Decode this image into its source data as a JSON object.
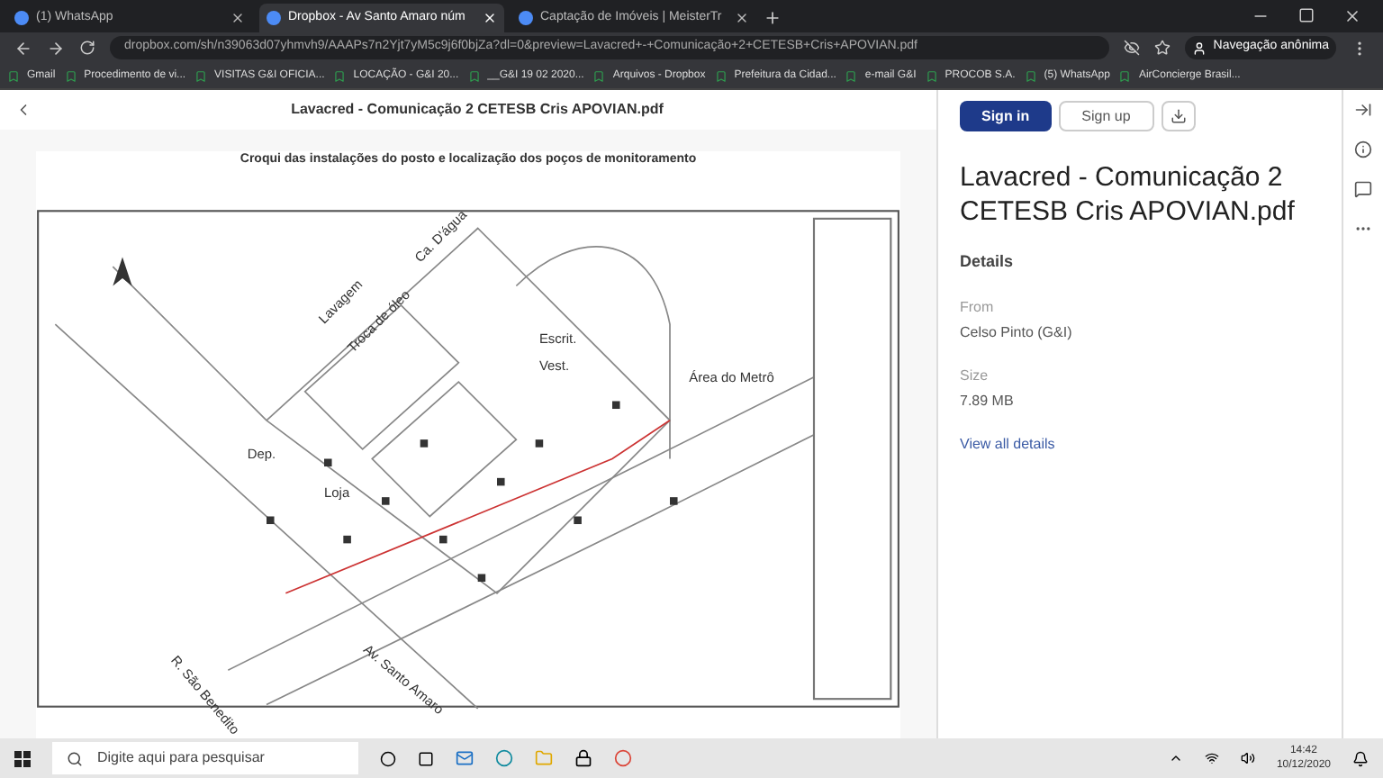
{
  "browser": {
    "tabs": [
      {
        "title": "(1) WhatsApp",
        "selected": false
      },
      {
        "title": "Dropbox - Av Santo Amaro núm",
        "selected": true
      },
      {
        "title": "Captação de Imóveis | MeisterTr",
        "selected": false
      }
    ],
    "url": "dropbox.com/sh/n39063d07yhmvh9/AAAPs7n2Yjt7yM5c9j6f0bjZa?dl=0&preview=Lavacred+-+Comunicação+2+CETESB+Cris+APOVIAN.pdf",
    "profile": "Navegação anônima",
    "bookmarks": [
      "Gmail",
      "Procedimento de vi...",
      "VISITAS G&I OFICIA...",
      "LOCAÇÃO - G&I 20...",
      "__G&I 19 02 2020...",
      "Arquivos - Dropbox",
      "Prefeitura da Cidad...",
      "e-mail G&I",
      "PROCOB S.A.",
      "(5) WhatsApp",
      "AirConcierge Brasil..."
    ]
  },
  "viewer": {
    "title": "Lavacred - Comunicação 2 CETESB Cris APOVIAN.pdf",
    "drawing_title": "Croqui das instalações do posto e localização dos poços de monitoramento",
    "map_labels": [
      "Área do Metrô",
      "Lavagem",
      "Dep.",
      "Loja",
      "Escrit.",
      "Vest.",
      "Ca. D'água",
      "Troca de óleo",
      "Av. Santo Amaro",
      "R. São Benedito"
    ]
  },
  "panel": {
    "sign_in": "Sign in",
    "sign_up": "Sign up",
    "file_title": "Lavacred - Comunicação 2 CETESB Cris APOVIAN.pdf",
    "details_heading": "Details",
    "details": [
      {
        "label": "From",
        "value": "Celso Pinto (G&I)"
      },
      {
        "label": "Size",
        "value": "7.89 MB"
      }
    ],
    "link": "View all details"
  },
  "taskbar": {
    "search_placeholder": "Digite aqui para pesquisar",
    "time": "14:42",
    "date": "10/12/2020"
  }
}
